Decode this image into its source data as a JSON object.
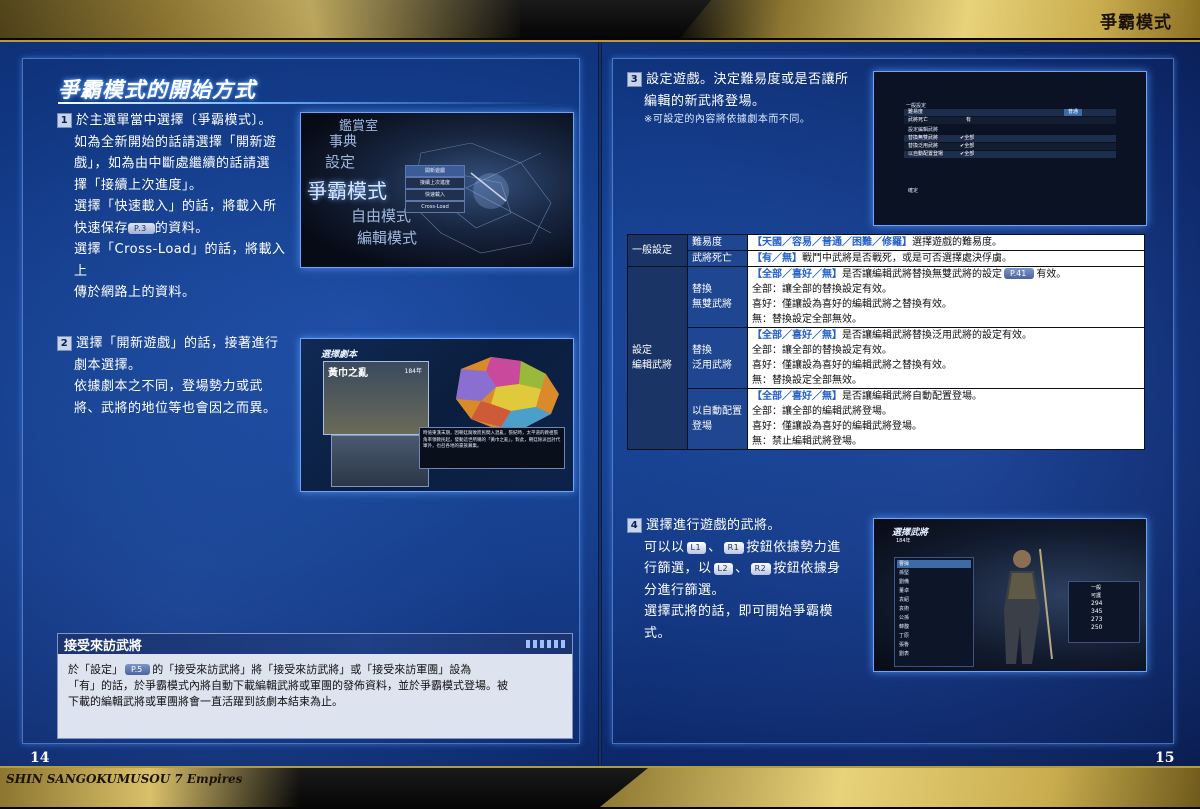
{
  "header": {
    "mode_title": "爭霸模式"
  },
  "footer": {
    "game_title": "SHIN SANGOKUMUSOU 7 Empires",
    "page_left": "14",
    "page_right": "15"
  },
  "section": {
    "title": "爭霸模式的開始方式"
  },
  "steps": {
    "s1": {
      "num": "1",
      "line1": "於主選單當中選擇〔爭霸模式〕。",
      "line2": "如為全新開始的話請選擇「開新遊",
      "line3": "戲」，如為由中斷處繼續的話請選",
      "line4": "擇「接續上次進度」。",
      "line5": "選擇「快速載入」的話，將載入所",
      "line6a": "快速保存",
      "ref": "P.3",
      "line6b": "的資料。",
      "line7": "選擇「Cross-Load」的話，將載入上",
      "line8": "傳於網路上的資料。"
    },
    "s2": {
      "num": "2",
      "line1": "選擇「開新遊戲」的話，接著進行",
      "line2": "劇本選擇。",
      "line3": "依據劇本之不同，登場勢力或武",
      "line4": "將、武將的地位等也會因之而異。"
    },
    "s3": {
      "num": "3",
      "line1": "設定遊戲。決定難易度或是否讓所",
      "line2": "編輯的新武將登場。",
      "note": "※可設定的內容將依據劇本而不同。"
    },
    "s4": {
      "num": "4",
      "line1": "選擇進行遊戲的武將。",
      "line2a": "可以以",
      "btn_l1": "L1",
      "sep1": "、",
      "btn_r1": "R1",
      "line2b": "按鈕依據勢力進",
      "line3a": "行篩選，以",
      "btn_l2": "L2",
      "sep2": "、",
      "btn_r2": "R2",
      "line3b": "按鈕依據身",
      "line4": "分進行篩選。",
      "line5": "選擇武將的話，即可開始爭霸模",
      "line6": "式。"
    }
  },
  "screenshot1": {
    "menu": [
      "鑑賞室",
      "事典",
      "設定",
      "爭霸模式",
      "自由模式",
      "編輯模式"
    ],
    "submenu": [
      "開新遊戲",
      "接續上次進度",
      "快速載入",
      "Cross-Load"
    ]
  },
  "screenshot2": {
    "header": "選擇劇本",
    "scenario": "黃巾之亂",
    "year": "184年",
    "desc": "時值東漢末期，因朝廷腐敗而民間入混亂，張紀時，太平道的教祖張角率領教民起，發動這世所稱的「黃巾之亂」，對此，朝廷除派出討代軍外，也召各地的豪族募集。"
  },
  "screenshot3": {
    "heading": "一般設定",
    "rows": [
      {
        "label": "難易度",
        "value": "普通"
      },
      {
        "label": "武將死亡",
        "value": "有"
      },
      {
        "label": "設定編輯武將",
        "value": ""
      },
      {
        "label": "替換無雙武將",
        "value": "✔全部"
      },
      {
        "label": "替換泛用武將",
        "value": "✔全部"
      },
      {
        "label": "以自動配置登場",
        "value": "✔全部"
      }
    ],
    "footer": "確定"
  },
  "screenshot4": {
    "header": "選擇武將",
    "year": "184年",
    "list": [
      "曹操",
      "孫堅",
      "劉備",
      "董卓",
      "袁紹",
      "袁術",
      "公孫",
      "韓馥",
      "丁原",
      "張魯",
      "劉表"
    ],
    "stats": [
      "一般",
      "可護",
      "294",
      "345",
      "273",
      "250"
    ]
  },
  "settings_table": {
    "group1": "一般設定",
    "difficulty": {
      "label": "難易度",
      "options": "【天國／容易／普通／困難／修羅】",
      "desc": "選擇遊戲的難易度。"
    },
    "death": {
      "label": "武將死亡",
      "options": "【有／無】",
      "desc": "戰鬥中武將是否戰死，或是可否選擇處決俘虜。"
    },
    "group2_line1": "設定",
    "group2_line2": "編輯武將",
    "musou": {
      "label1": "替換",
      "label2": "無雙武將",
      "options": "【全部／喜好／無】",
      "desc_a": "是否讓編輯武將替換無雙武將的設定",
      "ref": "P.41",
      "desc_b": "有效。",
      "all": "全部：讓全部的替換設定有效。",
      "fav": "喜好：僅讓設為喜好的編輯武將之替換有效。",
      "none": "無：替換設定全部無效。"
    },
    "generic": {
      "label1": "替換",
      "label2": "泛用武將",
      "options": "【全部／喜好／無】",
      "desc": "是否讓編輯武將替換泛用武將的設定有效。",
      "all": "全部：讓全部的替換設定有效。",
      "fav": "喜好：僅讓設為喜好的編輯武將之替換有效。",
      "none": "無：替換設定全部無效。"
    },
    "auto": {
      "label1": "以自動配置",
      "label2": "登場",
      "options": "【全部／喜好／無】",
      "desc": "是否讓編輯武將自動配置登場。",
      "all": "全部：讓全部的編輯武將登場。",
      "fav": "喜好：僅讓設為喜好的編輯武將登場。",
      "none": "無：禁止編輯武將登場。"
    }
  },
  "visitor_box": {
    "title": "接受來訪武將",
    "line1a": "於「設定」",
    "ref": "P.5",
    "line1b": "的「接受來訪武將」將「接受來訪武將」或「接受來訪軍團」設為",
    "line2": "「有」的話，於爭霸模式內將自動下載編輯武將或軍團的發佈資料，並於爭霸模式登場。被",
    "line3": "下載的編輯武將或軍團將會一直活躍到該劇本結束為止。"
  }
}
